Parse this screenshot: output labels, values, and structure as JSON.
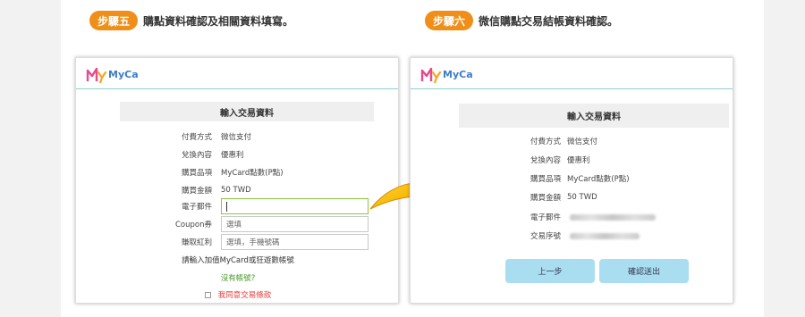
{
  "step5": {
    "badge": "步驟五",
    "text": "購點資料確認及相關資料填寫。"
  },
  "step6": {
    "badge": "步驟六",
    "text": "微信購點交易結帳資料確認。"
  },
  "logo_text": "MyCard",
  "left_card": {
    "title": "輸入交易資料",
    "rows": [
      {
        "label": "付費方式",
        "value": "微信支付"
      },
      {
        "label": "兌換內容",
        "value": "優惠利"
      },
      {
        "label": "購買品項",
        "value": "MyCard點數(P點)"
      },
      {
        "label": "購買金額",
        "value": "50 TWD"
      }
    ],
    "email_label": "電子郵件",
    "email_value": "",
    "coupon_label": "Coupon券",
    "coupon_placeholder": "選填",
    "bonus_label": "賺取紅利",
    "bonus_placeholder": "選填，手機號碼",
    "note": "請輸入加值MyCard或狂遊數帳號",
    "no_account_link": "沒有帳號?",
    "agree_text": "我同意交易條款"
  },
  "right_card": {
    "title": "輸入交易資料",
    "rows": [
      {
        "label": "付費方式",
        "value": "微信支付"
      },
      {
        "label": "兌換內容",
        "value": "優惠利"
      },
      {
        "label": "購買品項",
        "value": "MyCard點數(P點)"
      },
      {
        "label": "購買金額",
        "value": "50 TWD"
      }
    ],
    "email_label": "電子郵件",
    "serial_label": "交易序號",
    "back_button": "上一步",
    "confirm_button": "確認送出"
  },
  "colors": {
    "accent_orange": "#ef8f1a",
    "button_blue": "#a9def0",
    "agree_red": "#e43b3b",
    "link_green": "#4a9a2a",
    "rule_teal": "#8ed0cc"
  },
  "icons": {
    "arrow": "curved-arrow-icon",
    "checkbox": "checkbox-icon"
  }
}
